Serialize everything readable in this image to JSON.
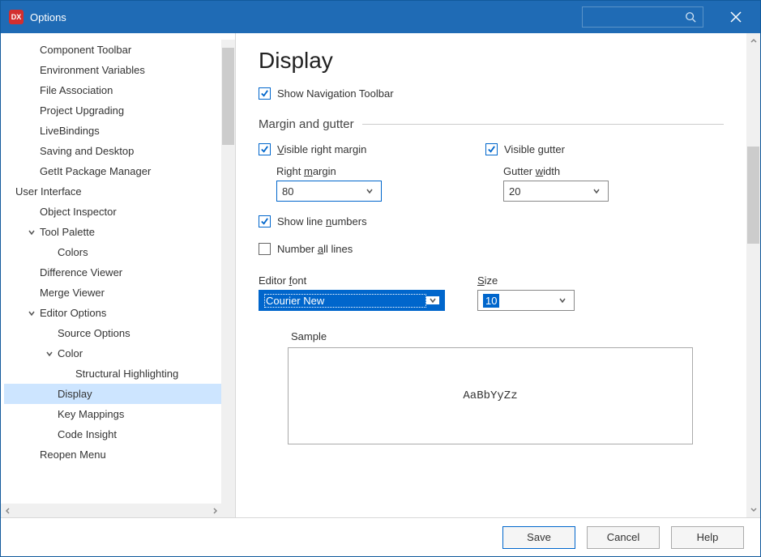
{
  "window": {
    "title": "Options"
  },
  "tree": {
    "items": [
      {
        "label": "Component Toolbar",
        "cls": "ind1"
      },
      {
        "label": "Environment Variables",
        "cls": "ind1"
      },
      {
        "label": "File Association",
        "cls": "ind1"
      },
      {
        "label": "Project Upgrading",
        "cls": "ind1"
      },
      {
        "label": "LiveBindings",
        "cls": "ind1"
      },
      {
        "label": "Saving and Desktop",
        "cls": "ind1"
      },
      {
        "label": "GetIt Package Manager",
        "cls": "ind1"
      },
      {
        "label": "User Interface",
        "cls": "ind0"
      },
      {
        "label": "Object Inspector",
        "cls": "ind1"
      },
      {
        "label": "Tool Palette",
        "cls": "ind1c",
        "chev": "down"
      },
      {
        "label": "Colors",
        "cls": "ind2"
      },
      {
        "label": "Difference Viewer",
        "cls": "ind1"
      },
      {
        "label": "Merge Viewer",
        "cls": "ind1"
      },
      {
        "label": "Editor Options",
        "cls": "ind1c",
        "chev": "down"
      },
      {
        "label": "Source Options",
        "cls": "ind2"
      },
      {
        "label": "Color",
        "cls": "ind2c",
        "chev": "down"
      },
      {
        "label": "Structural Highlighting",
        "cls": "ind3"
      },
      {
        "label": "Display",
        "cls": "ind2",
        "selected": true
      },
      {
        "label": "Key Mappings",
        "cls": "ind2"
      },
      {
        "label": "Code Insight",
        "cls": "ind2"
      },
      {
        "label": "Reopen Menu",
        "cls": "ind1"
      }
    ]
  },
  "page": {
    "heading": "Display",
    "show_nav": "Show Navigation Toolbar",
    "section1": "Margin and gutter",
    "visible_right_margin": "isible right margin",
    "visible_gutter": "Visible gutter",
    "right_margin_label": "argin",
    "right_margin_prefix": "Right ",
    "right_margin_value": "80",
    "gutter_width_label": "idth",
    "gutter_width_prefix": "Gutter ",
    "gutter_width_value": "20",
    "show_line_numbers": "Show line ",
    "show_line_numbers_suffix": "umbers",
    "number_all_lines": "Number ",
    "number_all_lines_suffix": "ll lines",
    "editor_font_label": "ont",
    "editor_font_prefix": "Editor ",
    "editor_font_value": "Courier New",
    "size_label": "ize",
    "size_value": "10",
    "sample_label": "Sample",
    "sample_text": "AaBbYyZz"
  },
  "footer": {
    "save": "Save",
    "cancel": "Cancel",
    "help": "Help"
  }
}
